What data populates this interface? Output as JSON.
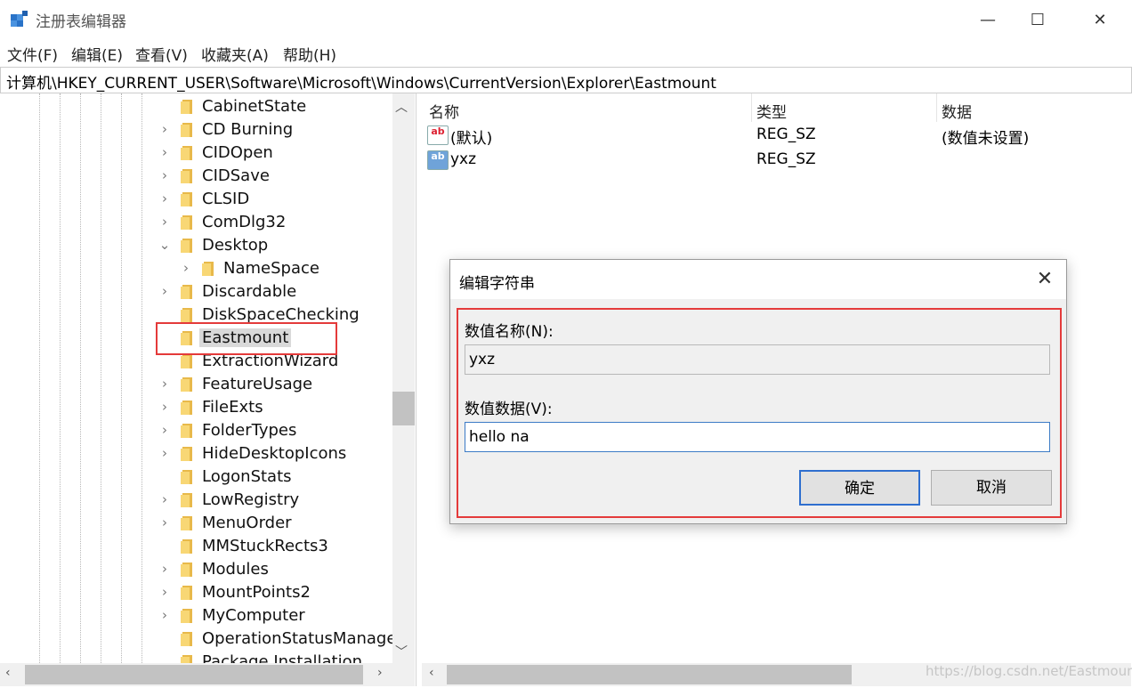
{
  "window": {
    "title": "注册表编辑器",
    "minimize_glyph": "—",
    "maximize_glyph": "☐",
    "close_glyph": "✕"
  },
  "menu": [
    "文件(F)",
    "编辑(E)",
    "查看(V)",
    "收藏夹(A)",
    "帮助(H)"
  ],
  "address": "计算机\\HKEY_CURRENT_USER\\Software\\Microsoft\\Windows\\CurrentVersion\\Explorer\\Eastmount",
  "tree": {
    "items": [
      {
        "label": "CabinetState",
        "expander": "none",
        "depth": 1
      },
      {
        "label": "CD Burning",
        "expander": "collapsed",
        "depth": 1
      },
      {
        "label": "CIDOpen",
        "expander": "collapsed",
        "depth": 1
      },
      {
        "label": "CIDSave",
        "expander": "collapsed",
        "depth": 1
      },
      {
        "label": "CLSID",
        "expander": "collapsed",
        "depth": 1
      },
      {
        "label": "ComDlg32",
        "expander": "collapsed",
        "depth": 1
      },
      {
        "label": "Desktop",
        "expander": "expanded",
        "depth": 1
      },
      {
        "label": "NameSpace",
        "expander": "collapsed",
        "depth": 2
      },
      {
        "label": "Discardable",
        "expander": "collapsed",
        "depth": 1
      },
      {
        "label": "DiskSpaceChecking",
        "expander": "none",
        "depth": 1
      },
      {
        "label": "Eastmount",
        "expander": "none",
        "depth": 1,
        "selected": true
      },
      {
        "label": "ExtractionWizard",
        "expander": "none",
        "depth": 1
      },
      {
        "label": "FeatureUsage",
        "expander": "collapsed",
        "depth": 1
      },
      {
        "label": "FileExts",
        "expander": "collapsed",
        "depth": 1
      },
      {
        "label": "FolderTypes",
        "expander": "collapsed",
        "depth": 1
      },
      {
        "label": "HideDesktopIcons",
        "expander": "collapsed",
        "depth": 1
      },
      {
        "label": "LogonStats",
        "expander": "none",
        "depth": 1
      },
      {
        "label": "LowRegistry",
        "expander": "collapsed",
        "depth": 1
      },
      {
        "label": "MenuOrder",
        "expander": "collapsed",
        "depth": 1
      },
      {
        "label": "MMStuckRects3",
        "expander": "none",
        "depth": 1
      },
      {
        "label": "Modules",
        "expander": "collapsed",
        "depth": 1
      },
      {
        "label": "MountPoints2",
        "expander": "collapsed",
        "depth": 1
      },
      {
        "label": "MyComputer",
        "expander": "collapsed",
        "depth": 1
      },
      {
        "label": "OperationStatusManage",
        "expander": "none",
        "depth": 1
      },
      {
        "label": "Package Installation",
        "expander": "none",
        "depth": 1
      }
    ]
  },
  "list": {
    "columns": [
      "名称",
      "类型",
      "数据"
    ],
    "rows": [
      {
        "name": "(默认)",
        "type": "REG_SZ",
        "data": "(数值未设置)",
        "icon": "ab"
      },
      {
        "name": "yxz",
        "type": "REG_SZ",
        "data": "",
        "icon": "ab"
      }
    ]
  },
  "dialog": {
    "title": "编辑字符串",
    "name_label": "数值名称(N):",
    "name_value": "yxz",
    "data_label": "数值数据(V):",
    "data_value": "hello na",
    "ok": "确定",
    "cancel": "取消"
  },
  "watermark": "https://blog.csdn.net/Eastmount",
  "colors": {
    "highlight": "#e43a3a",
    "folder": "#f8d775",
    "focus": "#2f6fcf"
  }
}
